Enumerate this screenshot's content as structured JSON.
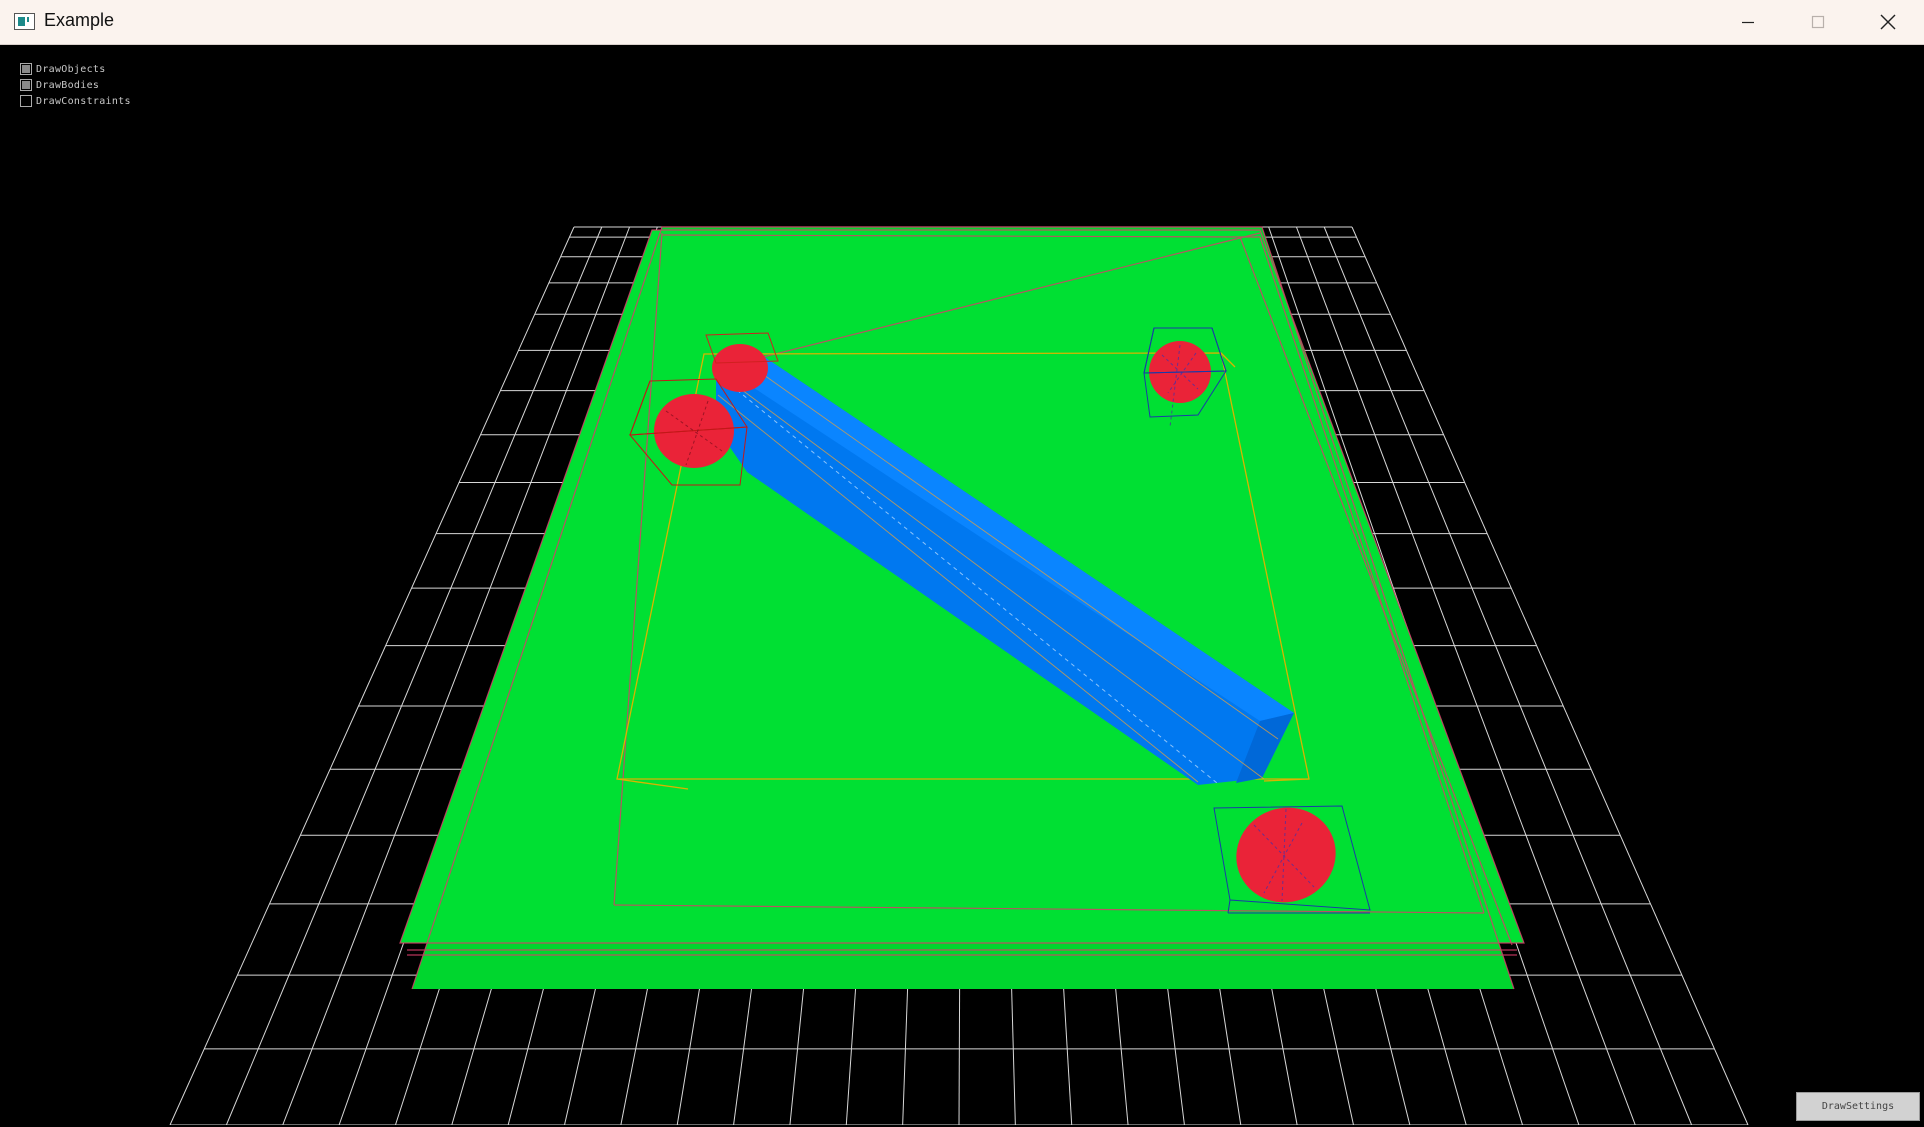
{
  "window": {
    "title": "Example",
    "controls": {
      "minimize": "minimize",
      "maximize": "maximize",
      "close": "close"
    }
  },
  "overlay": {
    "checkboxes": [
      {
        "label": "DrawObjects",
        "checked": true
      },
      {
        "label": "DrawBodies",
        "checked": true
      },
      {
        "label": "DrawConstraints",
        "checked": false
      }
    ]
  },
  "buttons": {
    "draw_settings": "DrawSettings"
  },
  "colors": {
    "ground": "#00e033",
    "bar": "#0078f0",
    "spheres": "#ea2338",
    "grid": "#d8d8d8",
    "bounds_yellow": "#d8b400",
    "bounds_red": "#c02020",
    "bounds_blue": "#1a3aa8",
    "background": "#000000",
    "titlebar": "#fbf3ee"
  },
  "icons": [
    "app-window-icon",
    "minimize-icon",
    "maximize-icon",
    "close-icon"
  ]
}
